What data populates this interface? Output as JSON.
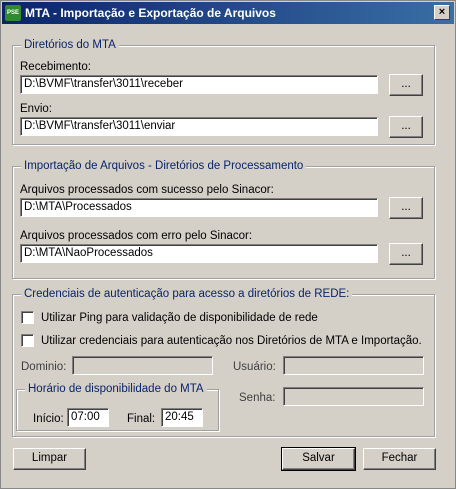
{
  "window": {
    "title": "MTA - Importação e Exportação de Arquivos",
    "icon_text": "PSE",
    "close_glyph": "×"
  },
  "dirs_mta": {
    "legend": "Diretórios do MTA",
    "receive_label": "Recebimento:",
    "receive_value": "D:\\BVMF\\transfer\\3011\\receber",
    "send_label": "Envio:",
    "send_value": "D:\\BVMF\\transfer\\3011\\enviar",
    "browse_label": "..."
  },
  "import_dirs": {
    "legend": "Importação de Arquivos - Diretórios de Processamento",
    "ok_label": "Arquivos processados com sucesso pelo Sinacor:",
    "ok_value": "D:\\MTA\\Processados",
    "err_label": "Arquivos processados com erro pelo Sinacor:",
    "err_value": "D:\\MTA\\NaoProcessados",
    "browse_label": "..."
  },
  "credentials": {
    "legend": "Credenciais de autenticação para acesso a diretórios de REDE:",
    "ping_label": "Utilizar Ping para validação de disponibilidade de rede",
    "ping_checked": false,
    "cred_label": "Utilizar credenciais para autenticação nos Diretórios de MTA e Importação.",
    "cred_checked": false,
    "domain_label": "Dominio:",
    "domain_value": "",
    "user_label": "Usuário:",
    "user_value": "",
    "password_label": "Senha:",
    "password_value": "",
    "schedule": {
      "legend": "Horário de disponibilidade do MTA",
      "start_label": "Início:",
      "start_value": "07:00",
      "end_label": "Final:",
      "end_value": "20:45"
    }
  },
  "footer": {
    "clear_label": "Limpar",
    "save_label": "Salvar",
    "close_label": "Fechar"
  }
}
